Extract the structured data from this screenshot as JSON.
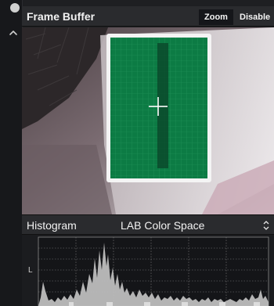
{
  "panel": {
    "title": "Frame Buffer",
    "zoom_label": "Zoom",
    "disable_label": "Disable"
  },
  "histogram": {
    "title": "Histogram",
    "color_space": "LAB Color Space",
    "channel_label": "L"
  },
  "colors": {
    "accent_green": "#0c7b44",
    "crosshair": "#ffffff"
  },
  "icons": {
    "collapse": "chevron-up-icon",
    "select_arrows": "updown-arrows-icon"
  }
}
